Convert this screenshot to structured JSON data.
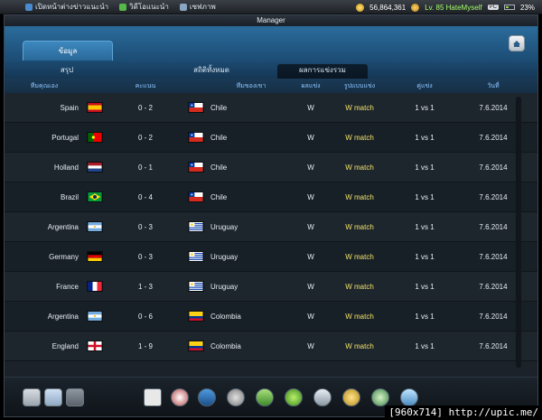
{
  "topbar": {
    "links": [
      "เปิดหน้าต่างข่าวแนะนำ",
      "วิดีโอแนะนำ",
      "เซฟภาพ"
    ],
    "money": "56,864,361",
    "level_text": "Lv. 85 HateMyself",
    "pc_badge": "PC",
    "battery_percent": "23%"
  },
  "window": {
    "title": "Manager"
  },
  "tabs": {
    "main": "ข้อมูล",
    "sub": [
      "สรุป",
      "สถิติทั้งหมด",
      "ผลการแข่งรวม"
    ]
  },
  "table": {
    "headers": [
      "ทีมคุณเอง",
      "คะแนน",
      "ทีมของเขา",
      "ผลแข่ง",
      "รูปแบบแข่ง",
      "คู่แข่ง",
      "วันที่"
    ],
    "rows": [
      {
        "team": "Spain",
        "score": "0 - 2",
        "opponent": "Chile",
        "result": "W",
        "mode": "W match",
        "vs": "1 vs 1",
        "date": "7.6.2014",
        "flag1": "spain",
        "flag2": "chile"
      },
      {
        "team": "Portugal",
        "score": "0 - 2",
        "opponent": "Chile",
        "result": "W",
        "mode": "W match",
        "vs": "1 vs 1",
        "date": "7.6.2014",
        "flag1": "portugal",
        "flag2": "chile"
      },
      {
        "team": "Holland",
        "score": "0 - 1",
        "opponent": "Chile",
        "result": "W",
        "mode": "W match",
        "vs": "1 vs 1",
        "date": "7.6.2014",
        "flag1": "holland",
        "flag2": "chile"
      },
      {
        "team": "Brazil",
        "score": "0 - 4",
        "opponent": "Chile",
        "result": "W",
        "mode": "W match",
        "vs": "1 vs 1",
        "date": "7.6.2014",
        "flag1": "brazil",
        "flag2": "chile"
      },
      {
        "team": "Argentina",
        "score": "0 - 3",
        "opponent": "Uruguay",
        "result": "W",
        "mode": "W match",
        "vs": "1 vs 1",
        "date": "7.6.2014",
        "flag1": "argentina",
        "flag2": "uruguay"
      },
      {
        "team": "Germany",
        "score": "0 - 3",
        "opponent": "Uruguay",
        "result": "W",
        "mode": "W match",
        "vs": "1 vs 1",
        "date": "7.6.2014",
        "flag1": "germany",
        "flag2": "uruguay"
      },
      {
        "team": "France",
        "score": "1 - 3",
        "opponent": "Uruguay",
        "result": "W",
        "mode": "W match",
        "vs": "1 vs 1",
        "date": "7.6.2014",
        "flag1": "france",
        "flag2": "uruguay"
      },
      {
        "team": "Argentina",
        "score": "0 - 6",
        "opponent": "Colombia",
        "result": "W",
        "mode": "W match",
        "vs": "1 vs 1",
        "date": "7.6.2014",
        "flag1": "argentina",
        "flag2": "colombia"
      },
      {
        "team": "England",
        "score": "1 - 9",
        "opponent": "Colombia",
        "result": "W",
        "mode": "W match",
        "vs": "1 vs 1",
        "date": "7.6.2014",
        "flag1": "england",
        "flag2": "colombia"
      }
    ]
  },
  "bottom_icons": [
    "profile-icon",
    "window-icon",
    "mail-icon",
    "card-icon",
    "ball-icon",
    "boot-icon",
    "trophy-icon",
    "rank-icon",
    "badge-2014-icon",
    "ticket-icon",
    "gold-icon",
    "club-icon",
    "shop-cart-icon"
  ],
  "watermark": "[960x714] http://upic.me/"
}
